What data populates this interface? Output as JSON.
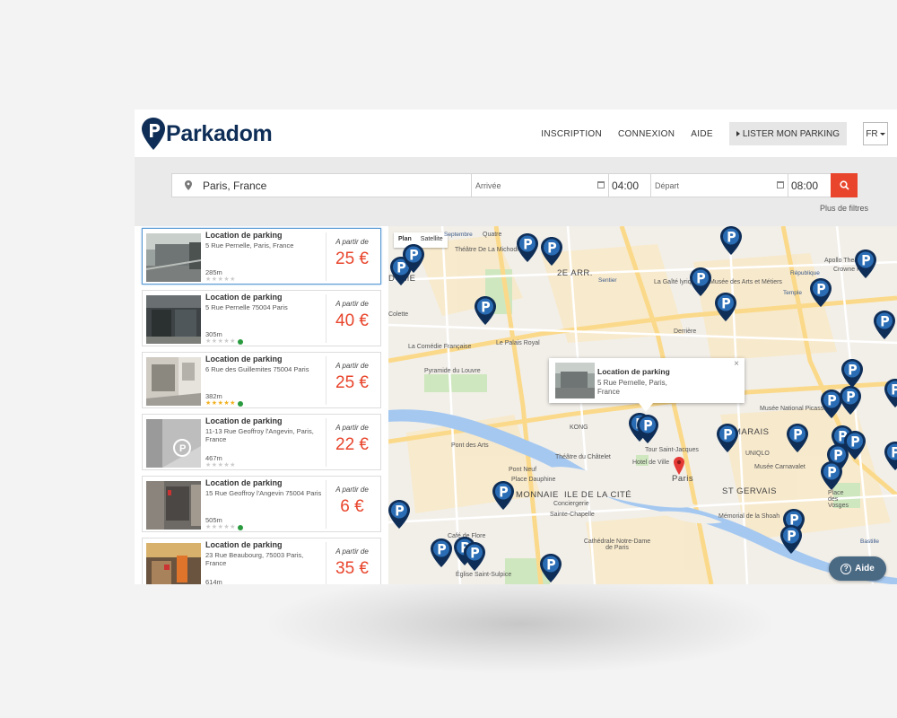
{
  "brand": {
    "name": "Parkadom",
    "navy": "#0f2e57",
    "accent": "#e8452c"
  },
  "nav": {
    "inscription": "INSCRIPTION",
    "connexion": "CONNEXION",
    "aide": "AIDE",
    "lister": "LISTER MON PARKING",
    "lang": "FR"
  },
  "search": {
    "location_value": "Paris, France",
    "arrival_label": "Arrivée",
    "arrival_time": "04:00",
    "departure_label": "Départ",
    "departure_time": "08:00",
    "more_filters": "Plus de filtres",
    "search_icon": "search-icon"
  },
  "listings": [
    {
      "title": "Location de parking",
      "address": "5 Rue Pernelle, Paris, France",
      "distance": "285m",
      "rating": 0,
      "verified": false,
      "from_label": "A partir de",
      "price": "25 €"
    },
    {
      "title": "Location de parking",
      "address": "5 Rue Pernelle 75004 Paris",
      "distance": "305m",
      "rating": 0,
      "verified": true,
      "from_label": "A partir de",
      "price": "40 €"
    },
    {
      "title": "Location de parking",
      "address": "6 Rue des Guillemites 75004 Paris",
      "distance": "382m",
      "rating": 5,
      "verified": true,
      "from_label": "A partir de",
      "price": "25 €"
    },
    {
      "title": "Location de parking",
      "address": "11-13 Rue Geoffroy l'Angevin, Paris, France",
      "distance": "467m",
      "rating": 0,
      "verified": false,
      "from_label": "A partir de",
      "price": "22 €"
    },
    {
      "title": "Location de parking",
      "address": "15 Rue Geoffroy l'Angevin 75004 Paris",
      "distance": "505m",
      "rating": 0,
      "verified": true,
      "from_label": "A partir de",
      "price": "6 €"
    },
    {
      "title": "Location de parking",
      "address": "23 Rue Beaubourg, 75003 Paris, France",
      "distance": "614m",
      "rating": 0,
      "verified": false,
      "from_label": "A partir de",
      "price": "35 €"
    }
  ],
  "map": {
    "types": {
      "plan": "Plan",
      "satellite": "Satellite"
    },
    "popup": {
      "title": "Location de parking",
      "address": "5 Rue Pernelle, Paris, France",
      "close": "×"
    },
    "labels": {
      "paris": "Paris",
      "marais": "MARAIS",
      "st_gervais": "ST GERVAIS",
      "monnaie": "MONNAIE",
      "ile_cite": "ILE DE LA CITÉ",
      "arr2": "2E ARR.",
      "vendome": "DÔME",
      "theatre_michodiere": "Théâtre De La Michodière",
      "palais_royal": "Le Palais Royal",
      "comedie": "La Comédie Française",
      "louvre": "Pyramide du Louvre",
      "pont_arts": "Pont des Arts",
      "pont_neuf": "Pont Neuf",
      "place_dauphine": "Place Dauphine",
      "conciergerie": "Conciergerie",
      "sainte_chapelle": "Sainte-Chapelle",
      "notre_dame": "Cathédrale Notre-Dame de Paris",
      "chatelet": "Théâtre du Châtelet",
      "tour_st_jacques": "Tour Saint-Jacques",
      "hotel_ville": "Hotel de Ville",
      "arts_metiers": "Musée des Arts et Métiers",
      "picasso": "Musée National Picasso",
      "carnavalet": "Musée Carnavalet",
      "shoah": "Mémorial de la Shoah",
      "vosges": "Place des Vosges",
      "saint_sulpice": "Église Saint-Sulpice",
      "cafe_flore": "Café de Flore",
      "kong": "KONG",
      "uniqlo": "UNIQLO",
      "gaite": "La Gaîté lyrique",
      "colette": "Colette",
      "derriere": "Derrière",
      "temple": "Temple",
      "republique": "République",
      "sentier": "Sentier",
      "bastille": "Bastille",
      "crowne": "Crowne Pla",
      "apollo": "Apollo Theatre",
      "septembre": "Septembre",
      "quatre": "Quatre"
    }
  },
  "help": {
    "label": "Aide"
  }
}
